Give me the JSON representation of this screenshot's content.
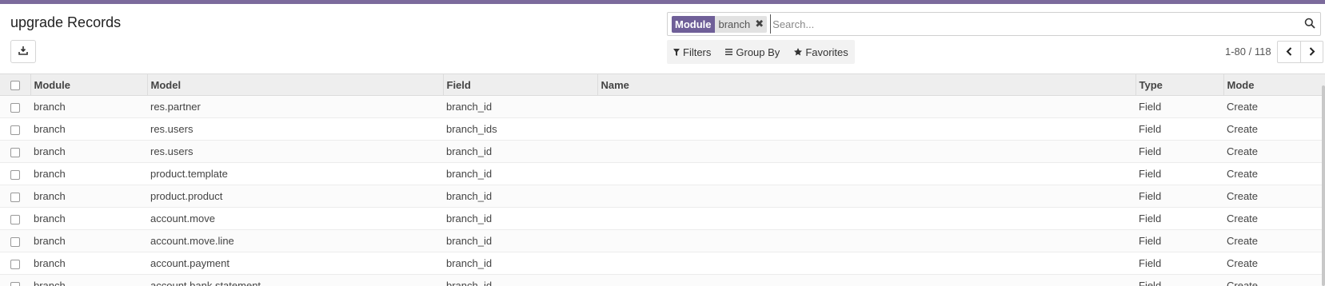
{
  "page": {
    "title": "upgrade Records"
  },
  "search": {
    "facet_label": "Module",
    "facet_value": "branch",
    "placeholder": "Search..."
  },
  "filters": {
    "filters_label": "Filters",
    "groupby_label": "Group By",
    "favorites_label": "Favorites"
  },
  "pager": {
    "value": "1-80 / 118"
  },
  "table": {
    "columns": [
      "Module",
      "Model",
      "Field",
      "Name",
      "Type",
      "Mode"
    ],
    "rows": [
      {
        "module": "branch",
        "model": "res.partner",
        "field": "branch_id",
        "name": "",
        "type": "Field",
        "mode": "Create"
      },
      {
        "module": "branch",
        "model": "res.users",
        "field": "branch_ids",
        "name": "",
        "type": "Field",
        "mode": "Create"
      },
      {
        "module": "branch",
        "model": "res.users",
        "field": "branch_id",
        "name": "",
        "type": "Field",
        "mode": "Create"
      },
      {
        "module": "branch",
        "model": "product.template",
        "field": "branch_id",
        "name": "",
        "type": "Field",
        "mode": "Create"
      },
      {
        "module": "branch",
        "model": "product.product",
        "field": "branch_id",
        "name": "",
        "type": "Field",
        "mode": "Create"
      },
      {
        "module": "branch",
        "model": "account.move",
        "field": "branch_id",
        "name": "",
        "type": "Field",
        "mode": "Create"
      },
      {
        "module": "branch",
        "model": "account.move.line",
        "field": "branch_id",
        "name": "",
        "type": "Field",
        "mode": "Create"
      },
      {
        "module": "branch",
        "model": "account.payment",
        "field": "branch_id",
        "name": "",
        "type": "Field",
        "mode": "Create"
      },
      {
        "module": "branch",
        "model": "account.bank.statement",
        "field": "branch_id",
        "name": "",
        "type": "Field",
        "mode": "Create"
      }
    ]
  },
  "colors": {
    "brand": "#7c6b9c",
    "facet": "#6f5f98",
    "header_bg": "#eeeeee"
  },
  "icons": [
    "download-icon",
    "search-icon",
    "filter-icon",
    "group-by-icon",
    "star-icon",
    "chevron-left-icon",
    "chevron-right-icon"
  ]
}
